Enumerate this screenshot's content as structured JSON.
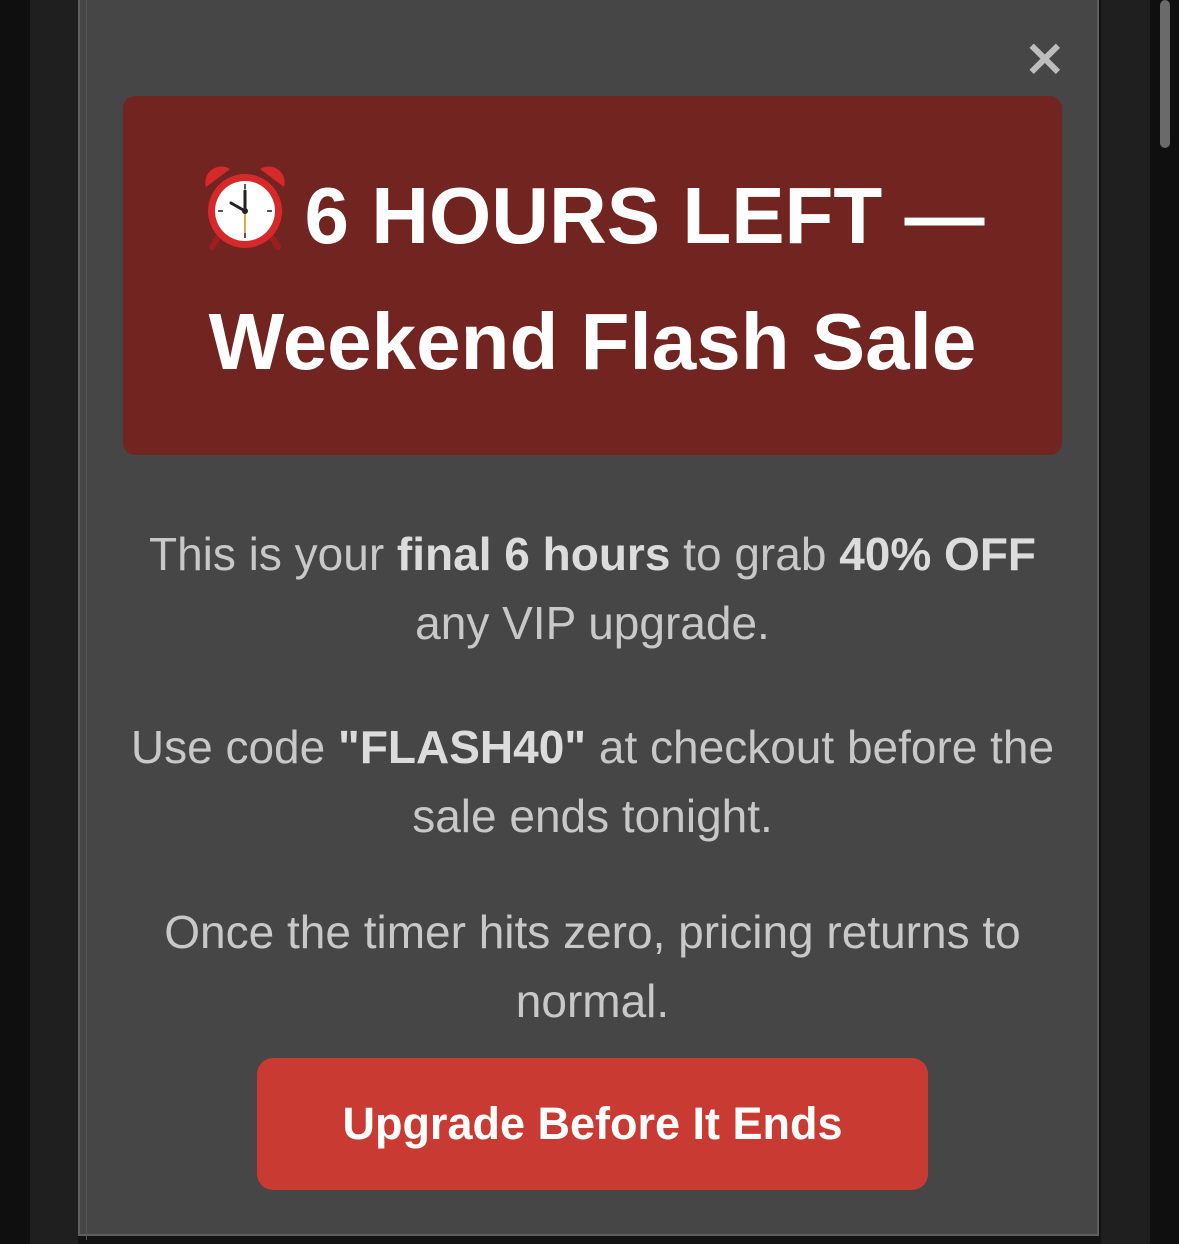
{
  "modal": {
    "close_label": "×",
    "banner": {
      "icon": "alarm-clock-icon",
      "title_line1": "6 HOURS LEFT —",
      "title_line2": "Weekend Flash Sale"
    },
    "paragraph1": {
      "pre": "This is your ",
      "bold1": "final 6 hours",
      "mid": " to grab ",
      "bold2": "40% OFF",
      "post": " any VIP upgrade."
    },
    "paragraph2": {
      "pre": "Use code ",
      "bold": "\"FLASH40\"",
      "post": " at checkout before the sale ends tonight."
    },
    "paragraph3": "Once the timer hits zero, pricing returns to normal.",
    "cta_label": "Upgrade Before It Ends"
  },
  "colors": {
    "modal_bg": "#464646",
    "banner_bg": "#722421",
    "cta_bg": "#c93a32",
    "body_text": "#c8c8c8"
  }
}
